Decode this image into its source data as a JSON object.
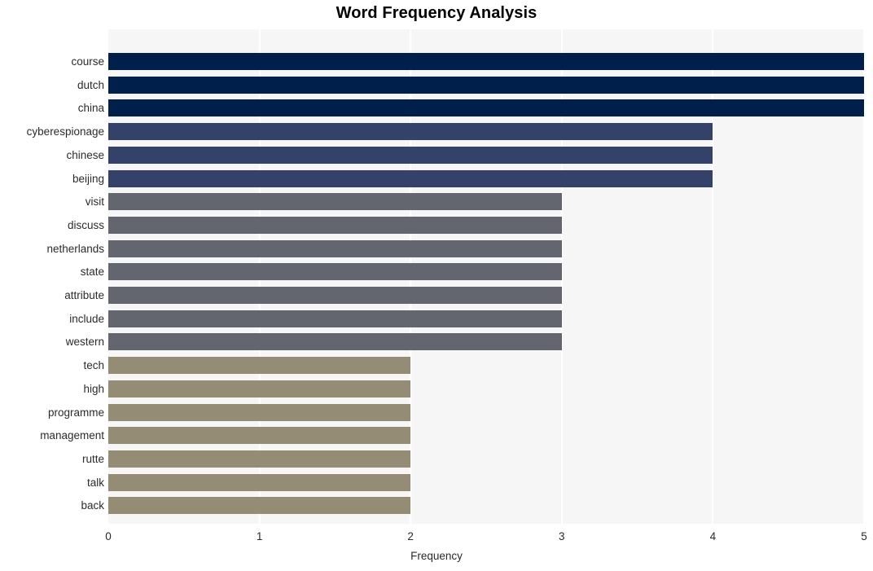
{
  "chart_data": {
    "type": "bar",
    "orientation": "horizontal",
    "title": "Word Frequency Analysis",
    "xlabel": "Frequency",
    "ylabel": "",
    "xlim": [
      0,
      5
    ],
    "xticks": [
      "0",
      "1",
      "2",
      "3",
      "4",
      "5"
    ],
    "xtick_values": [
      0,
      1,
      2,
      3,
      4,
      5
    ],
    "grid": true,
    "grid_axis": "x",
    "legend": "none",
    "categories": [
      "course",
      "dutch",
      "china",
      "cyberespionage",
      "chinese",
      "beijing",
      "visit",
      "discuss",
      "netherlands",
      "state",
      "attribute",
      "include",
      "western",
      "tech",
      "high",
      "programme",
      "management",
      "rutte",
      "talk",
      "back"
    ],
    "values": [
      5,
      5,
      5,
      4,
      4,
      4,
      3,
      3,
      3,
      3,
      3,
      3,
      3,
      2,
      2,
      2,
      2,
      2,
      2,
      2
    ],
    "bar_colors": [
      "#011f4b",
      "#011f4b",
      "#011f4b",
      "#344169",
      "#344169",
      "#344169",
      "#63656f",
      "#63656f",
      "#63656f",
      "#63656f",
      "#63656f",
      "#63656f",
      "#63656f",
      "#948c74",
      "#948c74",
      "#948c74",
      "#948c74",
      "#948c74",
      "#948c74",
      "#948c74"
    ]
  },
  "style": {
    "plot_background": "#f6f6f7",
    "page_background": "#ffffff",
    "gridline_color": "#ffffff",
    "text_color": "#2b2b2b",
    "title_color": "#000000"
  }
}
